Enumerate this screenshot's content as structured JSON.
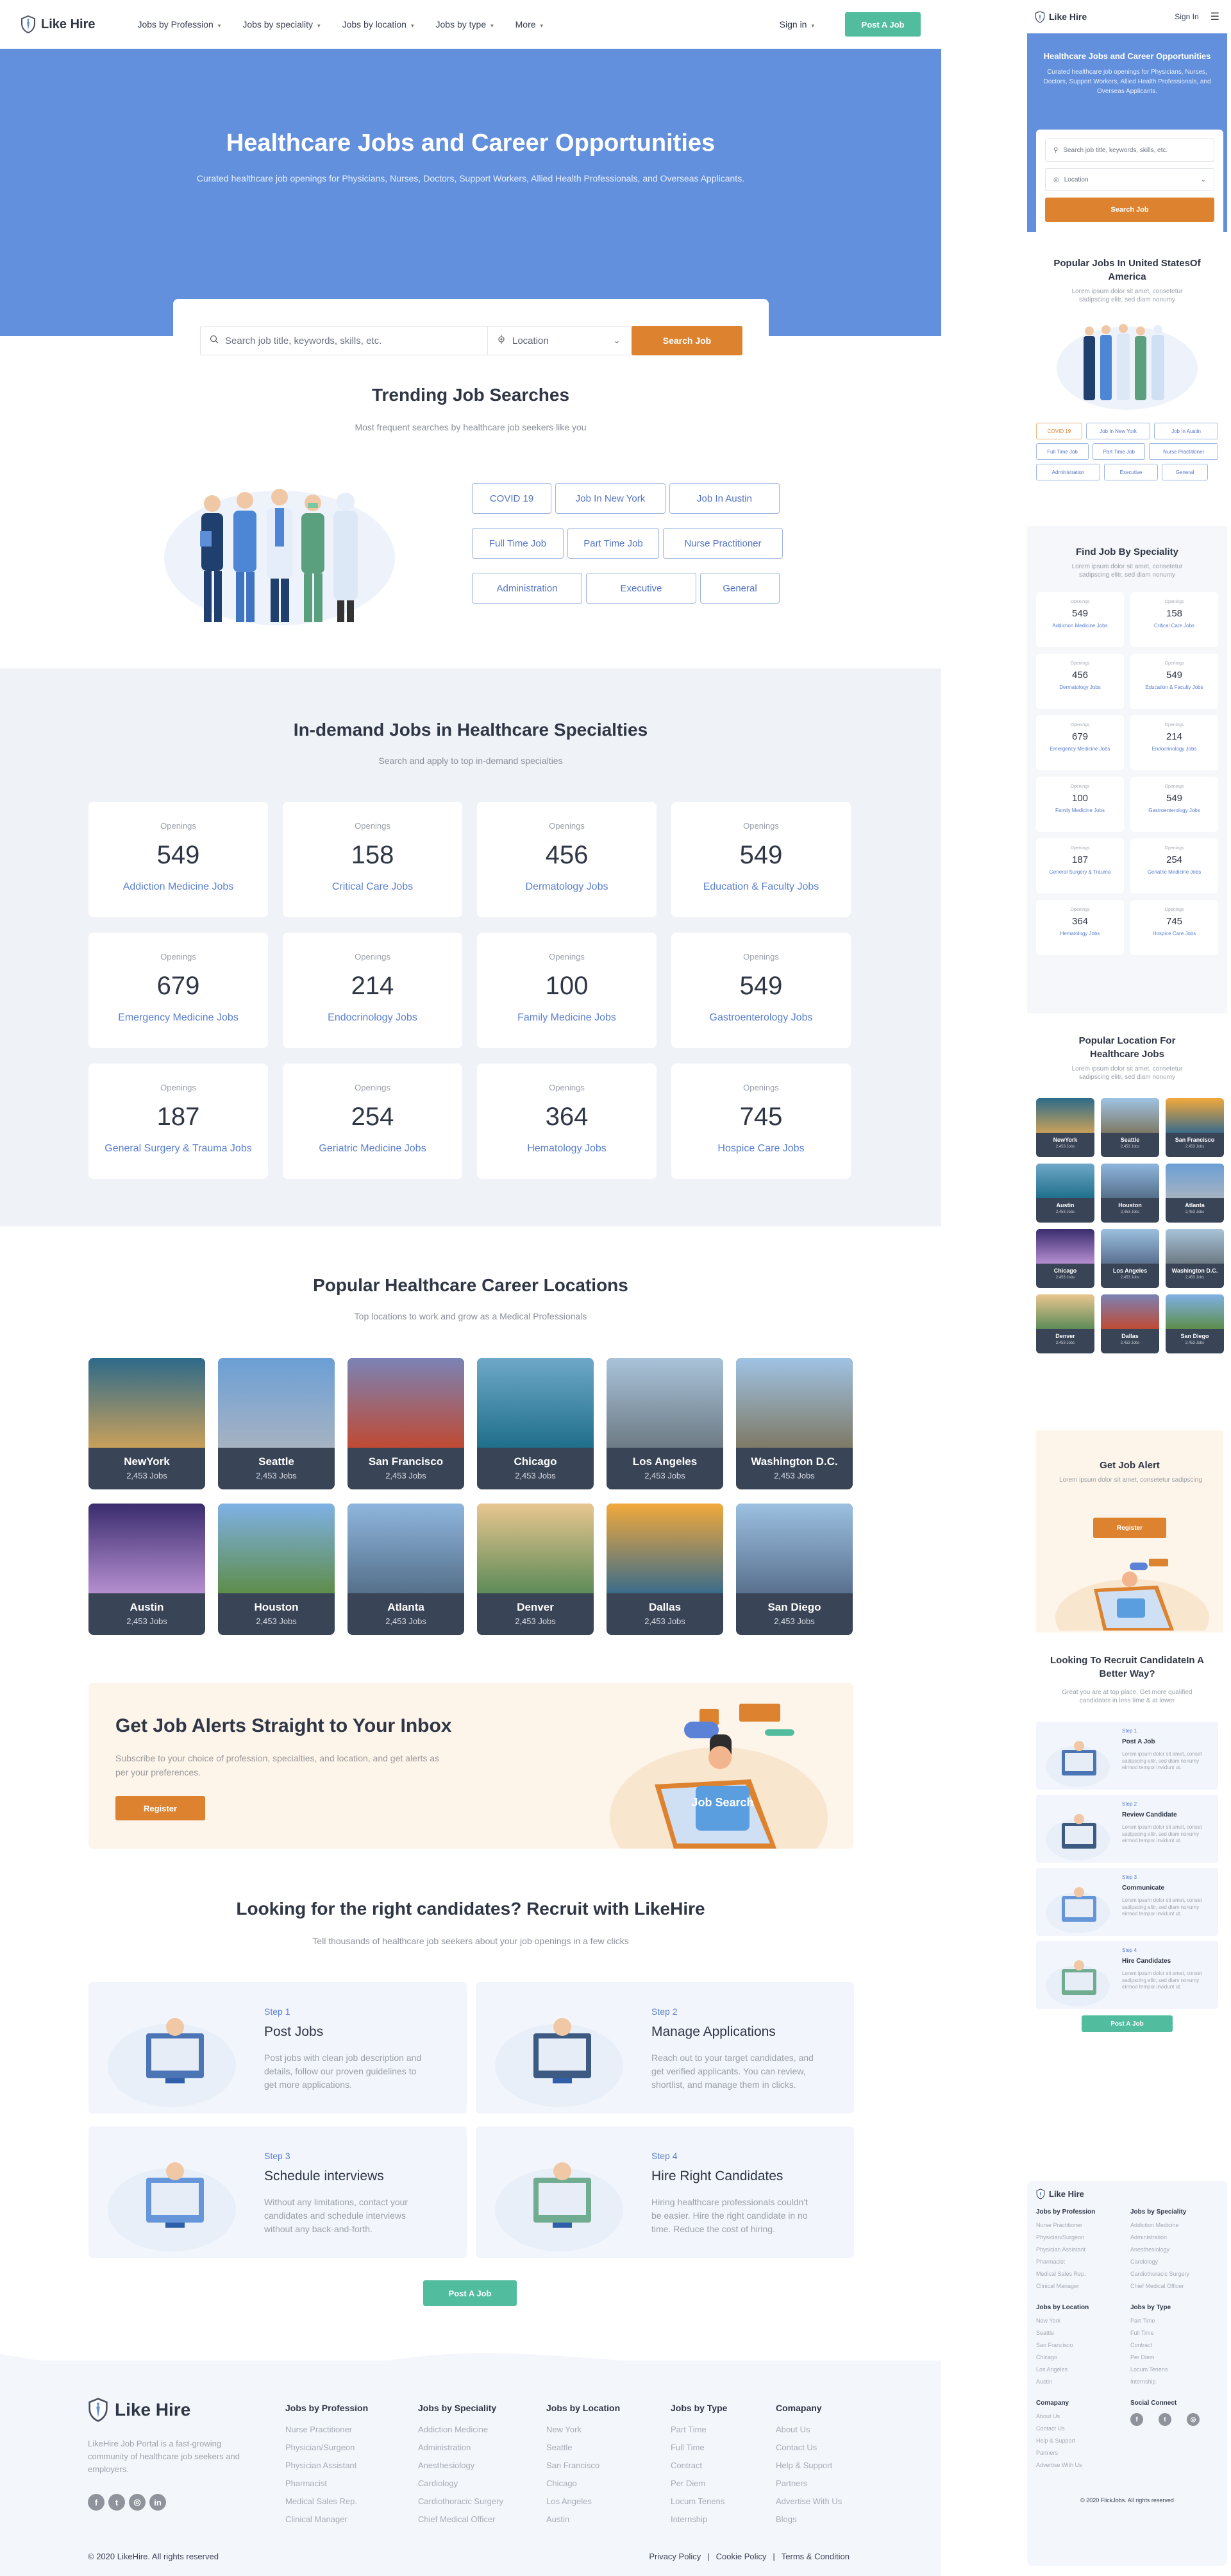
{
  "brand": {
    "name": "Like Hire",
    "accent": "#6290dc",
    "orange": "#dd8330",
    "green": "#52bd9e"
  },
  "header": {
    "nav": [
      {
        "label": "Jobs by Profession"
      },
      {
        "label": "Jobs by speciality"
      },
      {
        "label": "Jobs by location"
      },
      {
        "label": "Jobs by type"
      },
      {
        "label": "More"
      }
    ],
    "sign_in": "Sign in",
    "post_job": "Post A Job"
  },
  "hero": {
    "title": "Healthcare Jobs and Career Opportunities",
    "subtitle": "Curated healthcare job openings for Physicians, Nurses, Doctors, Support Workers, Allied Health Professionals, and Overseas Applicants.",
    "search_placeholder": "Search job title, keywords, skills, etc.",
    "location_value": "Location",
    "search_button": "Search Job"
  },
  "trending": {
    "title": "Trending Job Searches",
    "subtitle": "Most frequent searches by healthcare job seekers like you",
    "tags": [
      "COVID 19",
      "Job In New York",
      "Job In Austin",
      "Full Time Job",
      "Part Time Job",
      "Nurse Practitioner",
      "Administration",
      "Executive",
      "General"
    ]
  },
  "specialties": {
    "title": "In-demand Jobs in Healthcare Specialties",
    "subtitle": "Search and apply to top in-demand specialties",
    "openings_label": "Openings",
    "items": [
      {
        "count": "549",
        "name": "Addiction Medicine Jobs"
      },
      {
        "count": "158",
        "name": "Critical Care Jobs"
      },
      {
        "count": "456",
        "name": "Dermatology Jobs"
      },
      {
        "count": "549",
        "name": "Education & Faculty Jobs"
      },
      {
        "count": "679",
        "name": "Emergency Medicine Jobs"
      },
      {
        "count": "214",
        "name": "Endocrinology Jobs"
      },
      {
        "count": "100",
        "name": "Family Medicine Jobs"
      },
      {
        "count": "549",
        "name": "Gastroenterology Jobs"
      },
      {
        "count": "187",
        "name": "General Surgery & Trauma Jobs"
      },
      {
        "count": "254",
        "name": "Geriatric Medicine Jobs"
      },
      {
        "count": "364",
        "name": "Hematology Jobs"
      },
      {
        "count": "745",
        "name": "Hospice Care Jobs"
      }
    ]
  },
  "locations": {
    "title": "Popular Healthcare Career Locations",
    "subtitle": "Top locations to work and grow as a Medical Professionals",
    "items": [
      {
        "name": "NewYork",
        "jobs": "2,453 Jobs"
      },
      {
        "name": "Seattle",
        "jobs": "2,453 Jobs"
      },
      {
        "name": "San Francisco",
        "jobs": "2,453 Jobs"
      },
      {
        "name": "Chicago",
        "jobs": "2,453 Jobs"
      },
      {
        "name": "Los Angeles",
        "jobs": "2,453 Jobs"
      },
      {
        "name": "Washington D.C.",
        "jobs": "2,453 Jobs"
      },
      {
        "name": "Austin",
        "jobs": "2,453 Jobs"
      },
      {
        "name": "Houston",
        "jobs": "2,453 Jobs"
      },
      {
        "name": "Atlanta",
        "jobs": "2,453 Jobs"
      },
      {
        "name": "Denver",
        "jobs": "2,453 Jobs"
      },
      {
        "name": "Dallas",
        "jobs": "2,453 Jobs"
      },
      {
        "name": "San Diego",
        "jobs": "2,453 Jobs"
      }
    ]
  },
  "alert": {
    "title": "Get Job Alerts Straight to Your Inbox",
    "text": "Subscribe to your choice of profession, specialties, and location, and get alerts as per your preferences.",
    "button": "Register",
    "illustration_text": "Job Search"
  },
  "recruit": {
    "title": "Looking for the right candidates? Recruit with LikeHire",
    "subtitle": "Tell thousands of healthcare job seekers about your job openings in a few clicks",
    "steps": [
      {
        "step": "Step 1",
        "title": "Post Jobs",
        "text": "Post jobs with clean job description and details, follow our proven guidelines to get more applications."
      },
      {
        "step": "Step 2",
        "title": "Manage Applications",
        "text": "Reach out to your target candidates, and get verified applicants. You can review, shortlist, and manage them in clicks."
      },
      {
        "step": "Step 3",
        "title": "Schedule interviews",
        "text": "Without any limitations, contact your candidates and schedule interviews without any back-and-forth."
      },
      {
        "step": "Step 4",
        "title": "Hire Right Candidates",
        "text": "Hiring healthcare professionals couldn't be easier. Hire the right candidate in no time. Reduce the cost of hiring."
      }
    ],
    "button": "Post A Job"
  },
  "footer": {
    "about": "LikeHire Job Portal is a fast-growing community of healthcare job seekers and employers.",
    "social": [
      "f",
      "t",
      "ig",
      "in"
    ],
    "columns": [
      {
        "title": "Jobs by Profession",
        "links": [
          "Nurse Practitioner",
          "Physician/Surgeon",
          "Physician Assistant",
          "Pharmacist",
          "Medical Sales Rep.",
          "Clinical Manager"
        ]
      },
      {
        "title": "Jobs by Speciality",
        "links": [
          "Addiction Medicine",
          "Administration",
          "Anesthesiology",
          "Cardiology",
          "Cardiothoracic Surgery",
          "Chief Medical Officer"
        ]
      },
      {
        "title": "Jobs by Location",
        "links": [
          "New York",
          "Seattle",
          "San Francisco",
          "Chicago",
          "Los Angeles",
          "Austin"
        ]
      },
      {
        "title": "Jobs by Type",
        "links": [
          "Part Time",
          "Full Time",
          "Contract",
          "Per Diem",
          "Locum Tenens",
          "Internship"
        ]
      },
      {
        "title": "Comapany",
        "links": [
          "About Us",
          "Contact Us",
          "Help & Support",
          "Partners",
          "Advertise With Us",
          "Blogs"
        ]
      }
    ],
    "copyright": "© 2020 LikeHire. All rights reserved",
    "legal": [
      "Privacy Policy",
      "Cookie Policy",
      "Terms & Condition"
    ]
  },
  "mobile": {
    "sign_in": "Sign In",
    "hero_title": "Healthcare Jobs and Career Opportunities",
    "hero_subtitle": "Curated healthcare job openings for Physicians, Nurses, Doctors, Support Workers, Allied Health Professionals, and Overseas Applicants.",
    "search_placeholder": "Search job title, keywords, skills, etc.",
    "location_value": "Location",
    "search_button": "Search Job",
    "popular_title": "Popular Jobs In United StatesOf America",
    "lorem_short": "Lorem ipsum dolor sit amet, consetetur sadipscing elitr, sed diam nonumy",
    "tags": [
      "COVID 19",
      "Job In New York",
      "Job In Austin",
      "Full Time Job",
      "Part Time Job",
      "Nurse Practitioner",
      "Administration",
      "Executive",
      "General"
    ],
    "speciality_title": "Find Job By Speciality",
    "spec_names": [
      "Addiction Medicine Jobs",
      "Critical Care Jobs",
      "Dermatology Jobs",
      "Education & Faculty Jobs",
      "Emergency Medicine Jobs",
      "Endocrinology Jobs",
      "Family Medicine Jobs",
      "Gastroenterology Jobs",
      "General Surgery & Trauma",
      "Geriatric Medicine Jobs",
      "Hematology Jobs",
      "Hospice Care Jobs"
    ],
    "location_title": "Popular Location For Healthcare Jobs",
    "locations": [
      "NewYork",
      "Seattle",
      "San Francisco",
      "Austin",
      "Houston",
      "Atlanta",
      "Chicago",
      "Los Angeles",
      "Washington D.C.",
      "Denver",
      "Dallas",
      "San Diego"
    ],
    "alert_title": "Get Job Alert",
    "alert_text": "Lorem ipsum dolor sit amet, consetetur sadipscing",
    "alert_button": "Register",
    "recruit_title": "Looking To Recruit CandidateIn A Better Way?",
    "recruit_sub": "Great you are at top place. Get more qualified candidates in less time & at lower",
    "steps": [
      {
        "step": "Step 1",
        "title": "Post A Job"
      },
      {
        "step": "Step 2",
        "title": "Review Candidate"
      },
      {
        "step": "Step 3",
        "title": "Communicate"
      },
      {
        "step": "Step 4",
        "title": "Hire Candidates"
      }
    ],
    "step_text": "Lorem ipsum dolor sit amet, conset sadipscing elitr, sed diam nonumy eirmod tempor invidunt ut.",
    "post_button": "Post A Job",
    "footer_columns": [
      {
        "title": "Jobs by Profession",
        "links": [
          "Nurse Practitioner",
          "Physician/Surgeon",
          "Physician Assistant",
          "Pharmacist",
          "Medical Sales Rep.",
          "Clinical Manager"
        ]
      },
      {
        "title": "Jobs by Speciality",
        "links": [
          "Addiction Medicine",
          "Administration",
          "Anesthesiology",
          "Cardiology",
          "Cardiothoracic Surgery",
          "Chief Medical Officer"
        ]
      },
      {
        "title": "Jobs by Location",
        "links": [
          "New York",
          "Seattle",
          "San Francisco",
          "Chicago",
          "Los Angeles",
          "Austin"
        ]
      },
      {
        "title": "Jobs by Type",
        "links": [
          "Part Time",
          "Full Time",
          "Contract",
          "Per Diem",
          "Locum Tenens",
          "Internship"
        ]
      },
      {
        "title": "Comapany",
        "links": [
          "About Us",
          "Contact Us",
          "Help & Support",
          "Partners",
          "Advertise With Us"
        ]
      }
    ],
    "social_title": "Social Connect",
    "copyright": "© 2020 FlickJobs. All rights reserved"
  }
}
